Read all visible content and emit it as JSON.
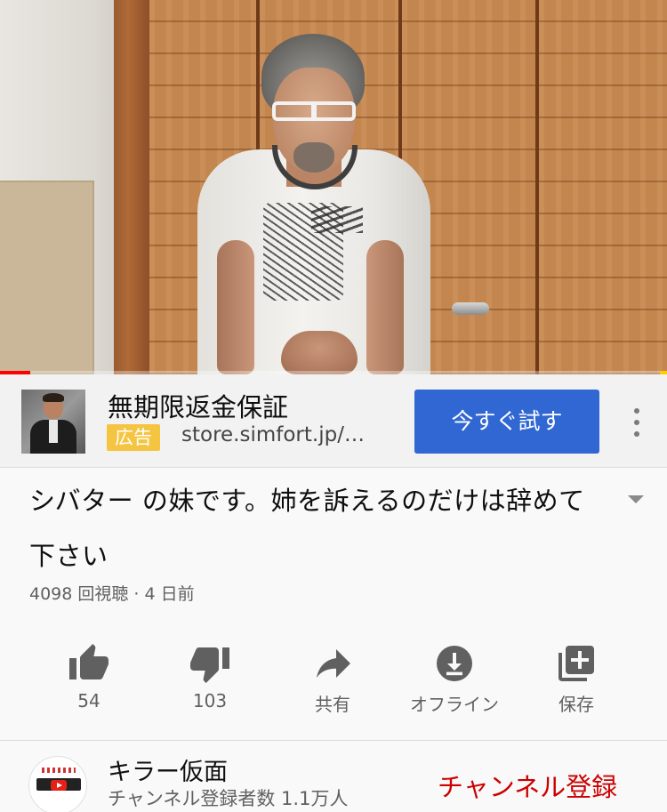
{
  "video": {
    "progress_fraction": 0.045
  },
  "ad": {
    "title": "無期限返金保証",
    "badge": "広告",
    "url": "store.simfort.jp/…",
    "cta_label": "今すぐ試す"
  },
  "video_info": {
    "title": "シバター の妹です。姉を訴えるのだけは辞めて下さい",
    "meta": "4098 回視聴 · 4 日前"
  },
  "actions": [
    {
      "icon": "thumbs-up-icon",
      "label": "54"
    },
    {
      "icon": "thumbs-down-icon",
      "label": "103"
    },
    {
      "icon": "share-icon",
      "label": "共有"
    },
    {
      "icon": "download-icon",
      "label": "オフライン"
    },
    {
      "icon": "add-to-playlist-icon",
      "label": "保存"
    }
  ],
  "channel": {
    "name": "キラー仮面",
    "subscribers": "チャンネル登録者数 1.1万人",
    "subscribe_label": "チャンネル登録"
  },
  "colors": {
    "cta_blue": "#3167d3",
    "ad_badge": "#f5c542",
    "subscribe_red": "#cc0000",
    "progress_red": "#ff0000"
  }
}
